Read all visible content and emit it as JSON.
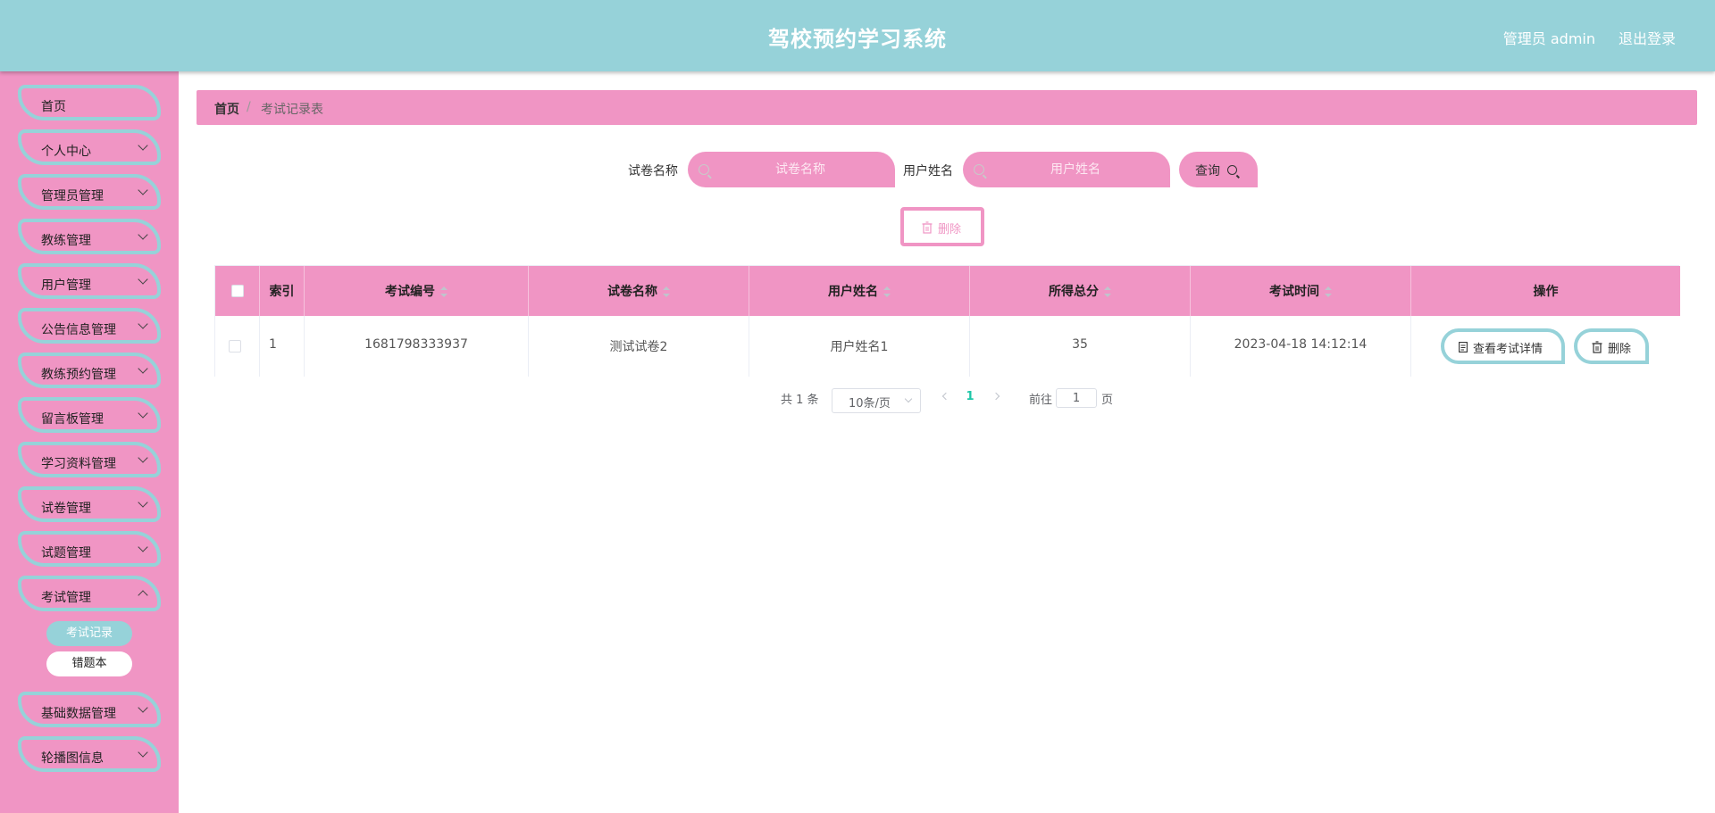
{
  "header": {
    "title": "驾校预约学习系统",
    "user": "管理员 admin",
    "logout": "退出登录"
  },
  "sidebar": {
    "items": [
      {
        "label": "首页"
      },
      {
        "label": "个人中心"
      },
      {
        "label": "管理员管理"
      },
      {
        "label": "教练管理"
      },
      {
        "label": "用户管理"
      },
      {
        "label": "公告信息管理"
      },
      {
        "label": "教练预约管理"
      },
      {
        "label": "留言板管理"
      },
      {
        "label": "学习资料管理"
      },
      {
        "label": "试卷管理"
      },
      {
        "label": "试题管理"
      },
      {
        "label": "考试管理"
      },
      {
        "label": "基础数据管理"
      },
      {
        "label": "轮播图信息"
      }
    ],
    "subitems": [
      {
        "label": "考试记录",
        "active": true
      },
      {
        "label": "错题本",
        "active": false
      }
    ]
  },
  "breadcrumb": {
    "home": "首页",
    "separator": "/",
    "current": "考试记录表"
  },
  "search": {
    "paper_label": "试卷名称",
    "paper_placeholder": "试卷名称",
    "user_label": "用户姓名",
    "user_placeholder": "用户姓名",
    "query_label": "查询"
  },
  "actions": {
    "delete_label": "删除"
  },
  "table": {
    "columns": [
      "索引",
      "考试编号",
      "试卷名称",
      "用户姓名",
      "所得总分",
      "考试时间",
      "操作"
    ],
    "rows": [
      {
        "index": "1",
        "exam_no": "1681798333937",
        "paper_name": "测试试卷2",
        "user_name": "用户姓名1",
        "score": "35",
        "exam_time": "2023-04-18 14:12:14",
        "view_label": "查看考试详情",
        "delete_label": "删除"
      }
    ]
  },
  "pagination": {
    "total": "共 1 条",
    "page_size": "10条/页",
    "current_page": "1",
    "goto_label": "前往",
    "goto_value": "1",
    "page_suffix": "页"
  },
  "colors": {
    "header": "#96d2d9",
    "sidebar": "#f095c4",
    "accent_teal": "#96d2d9",
    "accent_pink": "#f095c4",
    "active_page": "#1ec7a8"
  }
}
